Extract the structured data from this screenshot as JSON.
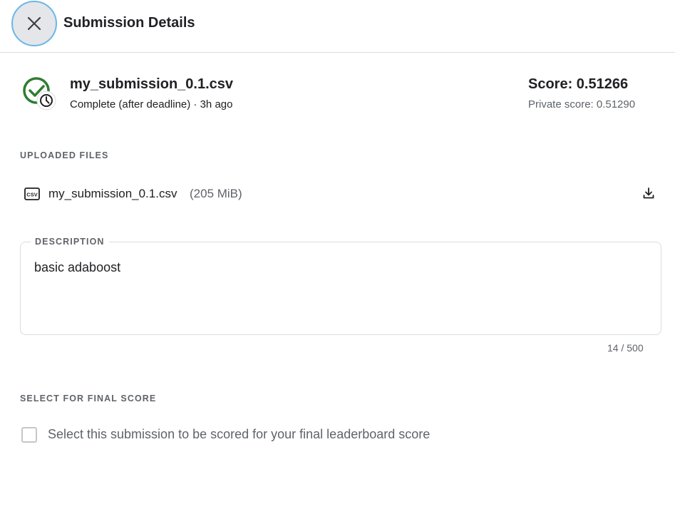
{
  "header": {
    "title": "Submission Details",
    "close_icon": "close-icon"
  },
  "submission": {
    "file_name": "my_submission_0.1.csv",
    "status": "Complete (after deadline) · 3h ago",
    "score": "Score: 0.51266",
    "private_score": "Private score: 0.51290",
    "status_icon": "check-circle-clock-icon",
    "status_color": "#2e7d32"
  },
  "uploaded_files": {
    "section_label": "UPLOADED FILES",
    "files": [
      {
        "name": "my_submission_0.1.csv",
        "size": "(205 MiB)",
        "icon": "csv-file-icon",
        "action_icon": "download-icon"
      }
    ]
  },
  "description": {
    "legend": "DESCRIPTION",
    "value": "basic adaboost",
    "counter": "14 / 500"
  },
  "final_score": {
    "section_label": "SELECT FOR FINAL SCORE",
    "checkbox_label": "Select this submission to be scored for your final leaderboard score",
    "checked": false
  }
}
